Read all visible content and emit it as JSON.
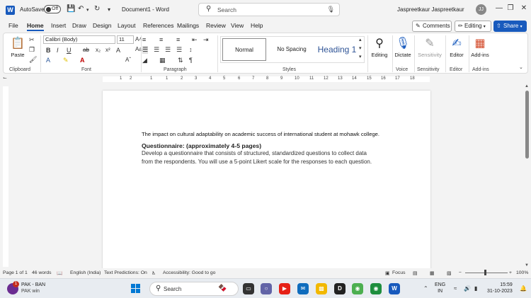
{
  "titlebar": {
    "autosave_label": "AutoSave",
    "autosave_state": "Off",
    "document_title": "Document1 - Word",
    "search_placeholder": "Search",
    "user_name": "Jaspreetkaur Jaspreetkaur",
    "avatar_initials": "JJ"
  },
  "menu": {
    "tabs": [
      "File",
      "Home",
      "Insert",
      "Draw",
      "Design",
      "Layout",
      "References",
      "Mailings",
      "Review",
      "View",
      "Help"
    ],
    "active_tab": "Home",
    "comments_label": "Comments",
    "editing_label": "Editing",
    "share_label": "Share"
  },
  "ribbon": {
    "groups": {
      "clipboard": "Clipboard",
      "font": "Font",
      "paragraph": "Paragraph",
      "styles": "Styles",
      "voice": "Voice",
      "sensitivity": "Sensitivity",
      "editor": "Editor",
      "addins": "Add-ins"
    },
    "paste_label": "Paste",
    "font_name": "Calibri (Body)",
    "font_size": "11",
    "styles": [
      "Normal",
      "No Spacing",
      "Heading 1"
    ],
    "editing_btn": "Editing",
    "dictate_btn": "Dictate",
    "sensitivity_btn": "Sensitivity",
    "editor_btn": "Editor",
    "addins_btn": "Add-ins"
  },
  "ruler": {
    "numbers": [
      "1",
      "2",
      "1",
      "1",
      "2",
      "3",
      "4",
      "5",
      "6",
      "7",
      "8",
      "9",
      "10",
      "11",
      "12",
      "13",
      "14",
      "15",
      "16",
      "17",
      "18"
    ]
  },
  "document": {
    "line1": "The impact on cultural adaptability on academic success of international student at mohawk college.",
    "heading": "Questionnaire: (approximately 4-5 pages)",
    "line3": "Develop a questionnaire that consists of structured, standardized questions to collect data",
    "line4": "from the respondents. You will use a 5-point Likert scale for the responses to each question."
  },
  "statusbar": {
    "page": "Page 1 of 1",
    "words": "46 words",
    "language": "English (India)",
    "predictions": "Text Predictions: On",
    "accessibility": "Accessibility: Good to go",
    "focus": "Focus",
    "zoom": "100%"
  },
  "taskbar": {
    "news_badge": "1",
    "news_title": "PAK - BAN",
    "news_sub": "PAK win",
    "search_placeholder": "Search",
    "lang_line1": "ENG",
    "lang_line2": "IN",
    "time": "15:59",
    "date": "31-10-2023"
  },
  "colors": {
    "word_blue": "#185abd",
    "heading_blue": "#2f5496"
  }
}
